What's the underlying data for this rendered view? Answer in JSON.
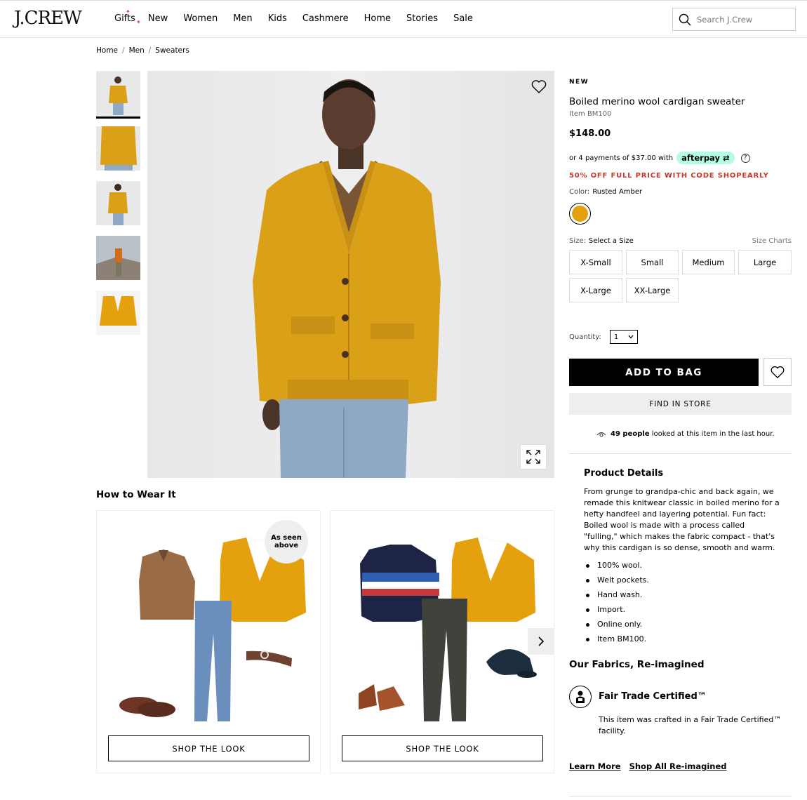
{
  "brand": {
    "logo": "J.CREW"
  },
  "nav": {
    "items": [
      "Gifts",
      "New",
      "Women",
      "Men",
      "Kids",
      "Cashmere",
      "Home",
      "Stories",
      "Sale"
    ],
    "search_placeholder": "Search J.Crew"
  },
  "breadcrumb": [
    "Home",
    "Men",
    "Sweaters"
  ],
  "product": {
    "badge": "NEW",
    "title": "Boiled merino wool cardigan sweater",
    "item": "Item BM100",
    "price": "$148.00",
    "afterpay_text": "or 4 payments of $37.00 with",
    "afterpay_brand": "afterpay",
    "promo": "50% OFF FULL PRICE WITH CODE SHOPEARLY",
    "color_label": "Color:",
    "color_value": "Rusted Amber",
    "swatch_color": "#e4a00d",
    "size_label": "Size:",
    "size_value": "Select a Size",
    "size_charts": "Size Charts",
    "sizes": [
      "X-Small",
      "Small",
      "Medium",
      "Large",
      "X-Large",
      "XX-Large"
    ],
    "quantity_label": "Quantity:",
    "quantity_value": "1",
    "add_to_bag": "ADD TO BAG",
    "find_in_store": "FIND IN STORE",
    "viewers_count": "49 people",
    "viewers_text": "looked at this item in the last hour."
  },
  "details": {
    "title": "Product Details",
    "description": "From grunge to grandpa-chic and back again, we remade this knitwear classic in boiled merino for a hefty handfeel and layering potential. Fun fact: Boiled wool is made with a process called \"fulling,\" which makes the fabric compact - that's why this cardigan is so dense, smooth and warm.",
    "bullets": [
      "100% wool.",
      "Welt pockets.",
      "Hand wash.",
      "Import.",
      "Online only.",
      "Item BM100."
    ]
  },
  "fabrics": {
    "title": "Our Fabrics, Re-imagined",
    "cert_title": "Fair Trade Certified™",
    "cert_desc": "This item was crafted in a Fair Trade Certified™ facility.",
    "link_learn": "Learn More",
    "link_shop": "Shop All Re-imagined"
  },
  "how_to_wear": {
    "title": "How to Wear It",
    "as_seen": "As seen above",
    "looks": [
      {
        "button": "SHOP THE LOOK"
      },
      {
        "button": "SHOP THE LOOK"
      }
    ]
  },
  "colors": {
    "amber": "#e4a00d",
    "promo_red": "#c53a2b",
    "afterpay_mint": "#b2fce4"
  }
}
